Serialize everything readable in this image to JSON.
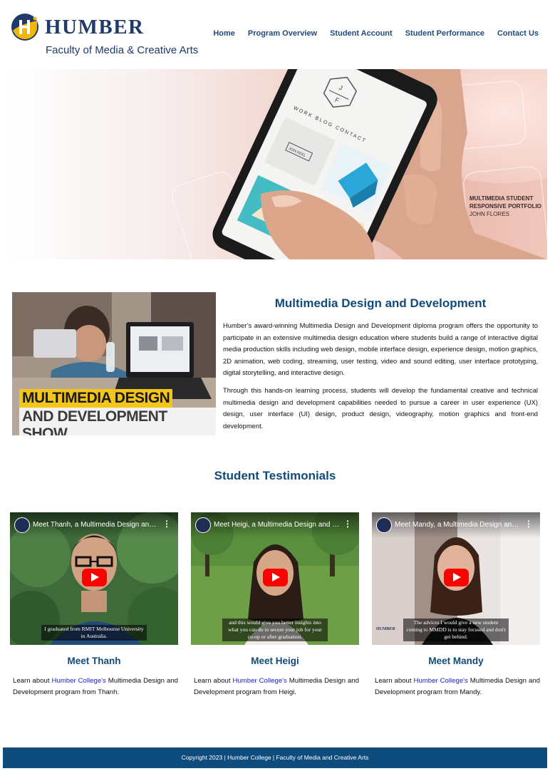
{
  "header": {
    "logo_word": "HUMBER",
    "logo_sub": "Faculty of Media & Creative Arts",
    "nav": [
      "Home",
      "Program Overview",
      "Student Account",
      "Student Performance",
      "Contact Us"
    ]
  },
  "hero": {
    "caption_line1": "MULTIMEDIA STUDENT",
    "caption_line2": "RESPONSIVE PORTFOLIO",
    "caption_line3": "JOHN FLORES",
    "phone_logo": "J F",
    "phone_menu": "WORK  BLOG  CONTACT",
    "phone_tag": "JOIN REEL"
  },
  "intro": {
    "image_text_line1": "MULTIMEDIA DESIGN",
    "image_text_line2": "AND DEVELOPMENT SHOW",
    "title": "Multimedia Design and Development",
    "paragraph1": "Humber’s award-winning Multimedia Design and Development diploma program offers the opportunity to participate in an extensive multimedia design education where students build a range of interactive digital media production skills including web design, mobile interface design, experience design, motion graphics, 2D animation, web coding, streaming, user testing, video and sound editing, user interface prototyping, digital storytelling, and interactive design.",
    "paragraph2": "Through this hands-on learning process, students will develop the fundamental creative and technical multimedia design and development capabilities needed to pursue a career in user experience (UX) design, user interface (UI) design, product design, videography, motion graphics and front-end development."
  },
  "testimonials": {
    "heading": "Student Testimonials",
    "cards": [
      {
        "video_title": "Meet Thanh, a Multimedia Design and D...",
        "subtitle": "I graduated from RMIT Melbourne University in Australia.",
        "name": "Meet Thanh",
        "text_before": "Learn about ",
        "link": "Humber College's",
        "text_after": " Multimedia Design and Development program from Thanh."
      },
      {
        "video_title": "Meet Heigi, a Multimedia Design and De...",
        "subtitle": "and this would give you better insights into what you can do to secure your job for your co-op or after graduation.",
        "name": "Meet Heigi",
        "text_before": "Learn about ",
        "link": "Humber College's",
        "text_after": " Multimedia Design and Development program from Heigi."
      },
      {
        "video_title": "Meet Mandy, a Multimedia Design and D...",
        "subtitle": "The advices I would give a new student coming to MMDD is to stay focused and don't get behind.",
        "name": "Meet Mandy",
        "text_before": "Learn about ",
        "link": "Humber College's",
        "text_after": " Multimedia Design and Development program from Mandy.",
        "watermark": "HUMBER"
      }
    ]
  },
  "footer": {
    "text": "Copyright 2023 | Humber College | Faculty of Media and Creative Arts"
  },
  "colors": {
    "brand_navy": "#1f3a6b",
    "heading_blue": "#124a7a",
    "footer_bg": "#0e4c7d",
    "link_blue": "#1a1adf",
    "logo_yellow": "#f2b705",
    "play_red": "#ff0000"
  }
}
